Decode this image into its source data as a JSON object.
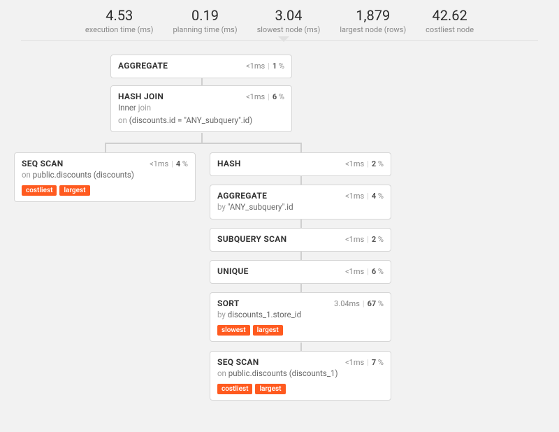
{
  "stats": {
    "execution_time": {
      "value": "4.53",
      "label": "execution time (ms)"
    },
    "planning_time": {
      "value": "0.19",
      "label": "planning time (ms)"
    },
    "slowest_node": {
      "value": "3.04",
      "label": "slowest node (ms)"
    },
    "largest_node": {
      "value": "1,879",
      "label": "largest node (rows)"
    },
    "costliest_node": {
      "value": "42.62",
      "label": "costliest node"
    }
  },
  "nodes": {
    "aggregate_top": {
      "title": "AGGREGATE",
      "time": "<1ms",
      "pct": "1"
    },
    "hash_join": {
      "title": "HASH JOIN",
      "time": "<1ms",
      "pct": "6",
      "detail_prefix": "Inner",
      "detail_kw": "join",
      "detail2_kw": "on",
      "detail2": "(discounts.id = \"ANY_subquery\".id)"
    },
    "seq_scan_left": {
      "title": "SEQ SCAN",
      "time": "<1ms",
      "pct": "4",
      "detail_kw": "on",
      "detail": "public.discounts (discounts)",
      "badge1": "costliest",
      "badge2": "largest"
    },
    "hash": {
      "title": "HASH",
      "time": "<1ms",
      "pct": "2"
    },
    "aggregate2": {
      "title": "AGGREGATE",
      "time": "<1ms",
      "pct": "4",
      "detail_kw": "by",
      "detail": "\"ANY_subquery\".id"
    },
    "subquery_scan": {
      "title": "SUBQUERY SCAN",
      "time": "<1ms",
      "pct": "2"
    },
    "unique": {
      "title": "UNIQUE",
      "time": "<1ms",
      "pct": "6"
    },
    "sort": {
      "title": "SORT",
      "time": "3.04ms",
      "pct": "67",
      "detail_kw": "by",
      "detail": "discounts_1.store_id",
      "badge1": "slowest",
      "badge2": "largest"
    },
    "seq_scan_bottom": {
      "title": "SEQ SCAN",
      "time": "<1ms",
      "pct": "7",
      "detail_kw": "on",
      "detail": "public.discounts (discounts_1)",
      "badge1": "costliest",
      "badge2": "largest"
    }
  }
}
